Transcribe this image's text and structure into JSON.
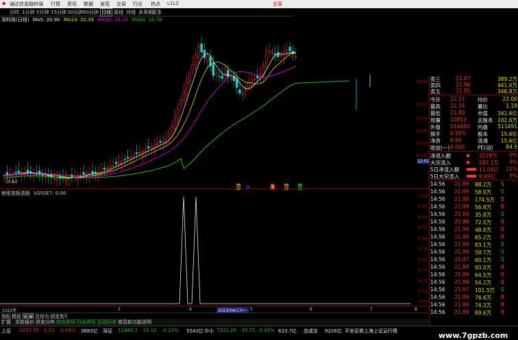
{
  "titlebar": {
    "title": "通达信金融终端",
    "menu": [
      "行情",
      "资讯",
      "数据",
      "发现",
      "交易",
      "行业",
      "热点",
      "L1L2"
    ],
    "trade": "交易"
  },
  "toolbar": {
    "items": [
      "分时",
      "1分钟",
      "5分钟",
      "15分钟",
      "30分钟",
      "60分钟",
      "日线",
      "周线",
      "月线",
      "多周期",
      "更多"
    ]
  },
  "chart": {
    "stock": "深科技(日线)",
    "ma": [
      {
        "label": "MA5: 20.90",
        "color": "#e8e8e8"
      },
      {
        "label": "MA10: 20.39",
        "color": "#e0e000"
      },
      {
        "label": "MA20: 20.23",
        "color": "#ff00ff"
      },
      {
        "label": "MA60: 19.78",
        "color": "#20c020"
      }
    ],
    "low_label": "10.63",
    "yticks": [
      "18.00",
      "17.00",
      "16.00",
      "15.00",
      "14.00",
      "13.00",
      "12.01"
    ],
    "markers": [
      "融",
      "财",
      "涨",
      "聪",
      "减"
    ],
    "current_price_tag": "12.01"
  },
  "indicator": {
    "name": "绝密连板选股",
    "param": "VSSSE7: 0.00",
    "yticks": [
      "1.00",
      "0.90",
      "0.80",
      "0.70",
      "0.60",
      "0.50",
      "0.40",
      "0.30",
      "0.20",
      "0.10",
      "0.00"
    ]
  },
  "xaxis": {
    "labels": [
      "2022年",
      "3",
      "4",
      "2023/04/17/一",
      "5",
      "6",
      "7",
      "8"
    ]
  },
  "bottom_tabs": [
    "指标",
    "模板",
    "管理",
    "另存为",
    "调宝到",
    "1"
  ],
  "sub_tabs": [
    "扩展",
    "关联报价",
    "资金分布",
    "综合资讯",
    "行业资讯",
    "互动问答",
    "普及新功能说明"
  ],
  "panel": {
    "sells": [
      {
        "label": "卖三",
        "price": "21.87",
        "vol": "389.2万"
      },
      {
        "label": "卖四",
        "price": "21.86",
        "vol": "441.6万"
      },
      {
        "label": "卖五",
        "price": "21.85",
        "vol": "346.8万"
      }
    ],
    "stats": [
      {
        "k1": "今开",
        "v1": "22.11",
        "k2": "均价",
        "v2": "22.00"
      },
      {
        "k1": "最高",
        "v1": "22.34",
        "k2": "量比",
        "v2": "1.19"
      },
      {
        "k1": "最低",
        "v1": "21.80",
        "k2": "市值",
        "v2": "341.6亿"
      },
      {
        "k1": "现量",
        "v1": "10853",
        "k2": "总股本",
        "v2": "102.6万"
      },
      {
        "k1": "外盘",
        "v1": "514680",
        "k2": "内盘",
        "v2": "511491"
      },
      {
        "k1": "换手",
        "v1": "6.58%",
        "k2": "股本",
        "v2": "15.6亿"
      },
      {
        "k1": "净资",
        "v1": "6.66",
        "k2": "流通",
        "v2": "15.6亿"
      },
      {
        "k1": "收益(一)",
        "v1": "0.065",
        "k2": "PE(动)",
        "v2": "84.5"
      }
    ],
    "flows": [
      {
        "label": "净流入额",
        "val": "3518万",
        "pct": "0%"
      },
      {
        "label": "大宗流入",
        "val": "587.1万",
        "pct": "0%"
      },
      {
        "label": "5日净流入额",
        "val": "11.04亿",
        "pct": "11%"
      },
      {
        "label": "5日大宗流入",
        "val": "8.69亿",
        "pct": "9%"
      }
    ],
    "ticks": [
      {
        "t": "14:56",
        "p": "21.89",
        "v": "88.2万",
        "s": "S"
      },
      {
        "t": "14:56",
        "p": "21.89",
        "v": "58.0万",
        "s": "S"
      },
      {
        "t": "14:56",
        "p": "21.89",
        "v": "174.5万",
        "s": "B"
      },
      {
        "t": "14:56",
        "p": "21.89",
        "v": "56.8万",
        "s": "B"
      },
      {
        "t": "14:56",
        "p": "21.89",
        "v": "35.8万",
        "s": "S"
      },
      {
        "t": "14:56",
        "p": "21.89",
        "v": "72.5万",
        "s": "B"
      },
      {
        "t": "14:56",
        "p": "21.89",
        "v": "48.6万",
        "s": "B"
      },
      {
        "t": "14:56",
        "p": "21.89",
        "v": "65.2万",
        "s": "B"
      },
      {
        "t": "14:56",
        "p": "21.89",
        "v": "83.1万",
        "s": "S"
      },
      {
        "t": "14:56",
        "p": "21.89",
        "v": "59.7万",
        "s": "S"
      },
      {
        "t": "14:56",
        "p": "21.87",
        "v": "60.1万",
        "s": "S"
      },
      {
        "t": "14:56",
        "p": "21.89",
        "v": "93.0万",
        "s": "B"
      },
      {
        "t": "14:56",
        "p": "21.89",
        "v": "64.5万",
        "s": "B"
      },
      {
        "t": "14:56",
        "p": "21.89",
        "v": "54.2万",
        "s": "B"
      },
      {
        "t": "14:56",
        "p": "21.87",
        "v": "101.5万",
        "s": "S"
      },
      {
        "t": "14:56",
        "p": "21.89",
        "v": "78.6万",
        "s": "B"
      },
      {
        "t": "14:56",
        "p": "21.89",
        "v": "74.3万",
        "s": "B"
      },
      {
        "t": "14:56",
        "p": "21.89",
        "v": "89.6万",
        "s": "B"
      }
    ]
  },
  "status": {
    "sh_label": "上证",
    "sh_val": "3237.70",
    "sh_chg": "1.22",
    "sh_pct": "0.04%",
    "sh_amt": "3683亿",
    "sz_label": "深证",
    "sz_val": "11880.3",
    "sz_chg": "-15.12",
    "sz_pct": "-0.13%",
    "sz_amt": "5542亿",
    "zx_label": "中小",
    "zx_val": "7221.29",
    "zx_chg": "-30.72",
    "zx_pct": "-0.42%",
    "zx_amt": "623.7亿",
    "total_label": "总成交",
    "total_val": "9226亿",
    "broker": "平安证券上海上证云行情"
  },
  "watermark": "www.7gpzb.com"
}
